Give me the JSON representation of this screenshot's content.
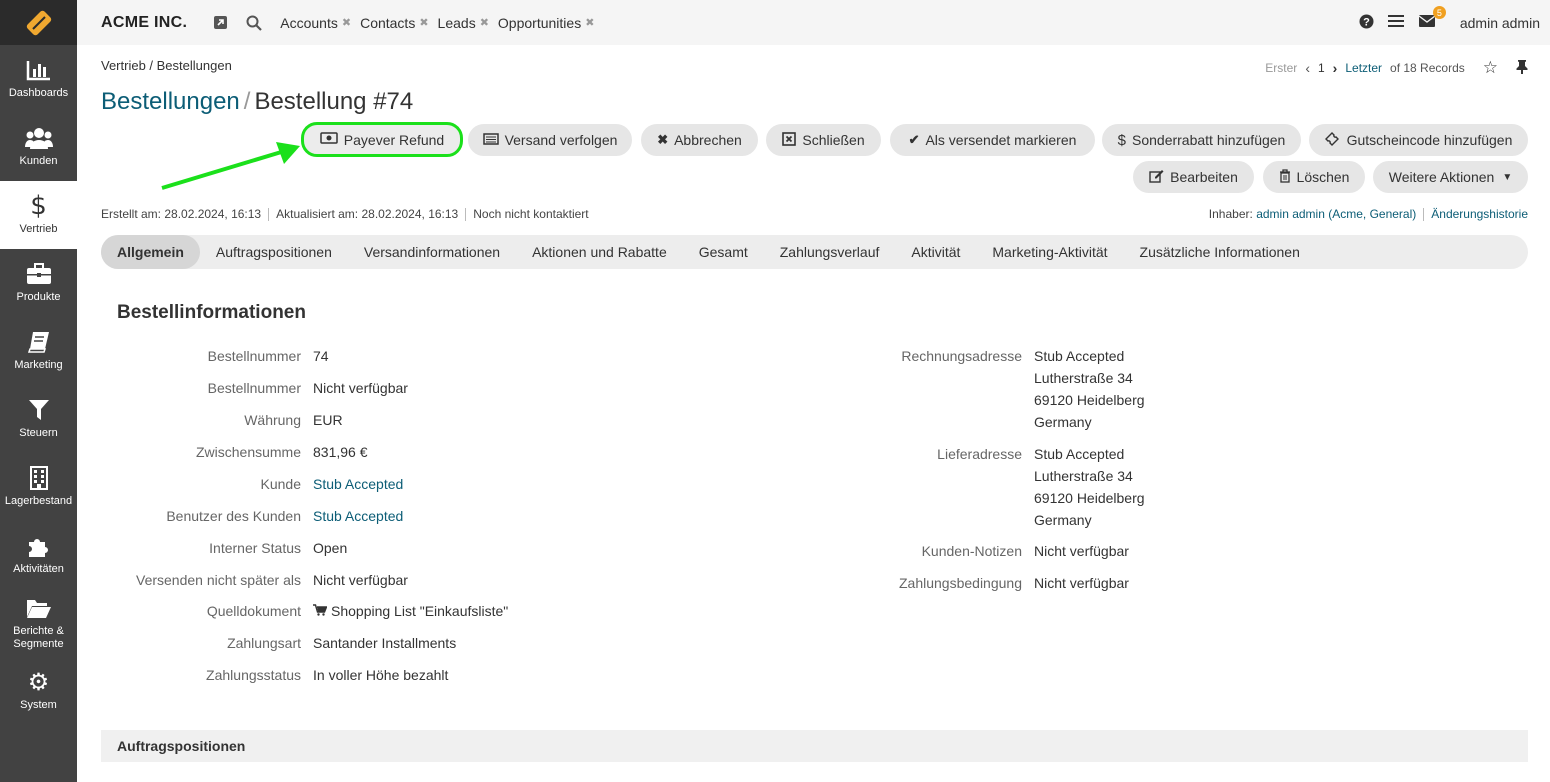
{
  "app": {
    "brand": "ACME INC."
  },
  "sidebar": {
    "items": [
      {
        "label": "Dashboards",
        "icon": "bar-chart-icon"
      },
      {
        "label": "Kunden",
        "icon": "users-icon"
      },
      {
        "label": "Vertrieb",
        "icon": "dollar-icon",
        "active": true
      },
      {
        "label": "Produkte",
        "icon": "briefcase-icon"
      },
      {
        "label": "Marketing",
        "icon": "book-icon"
      },
      {
        "label": "Steuern",
        "icon": "filter-icon"
      },
      {
        "label": "Lagerbestand",
        "icon": "building-icon"
      },
      {
        "label": "Aktivitäten",
        "icon": "puzzle-icon"
      },
      {
        "label": "Berichte & Segmente",
        "icon": "folder-icon"
      },
      {
        "label": "System",
        "icon": "gear-icon"
      }
    ]
  },
  "topbar": {
    "shortcuts": [
      "Accounts",
      "Contacts",
      "Leads",
      "Opportunities"
    ],
    "notification_count": "5",
    "user": "admin admin"
  },
  "breadcrumb": "Vertrieb / Bestellungen",
  "pager": {
    "first": "Erster",
    "page": "1",
    "last": "Letzter",
    "records": "of 18 Records"
  },
  "title": {
    "entity": "Bestellungen",
    "separator": "/",
    "record": "Bestellung #74"
  },
  "actions": {
    "payever_refund": "Payever Refund",
    "track_shipping": "Versand verfolgen",
    "cancel": "Abbrechen",
    "close": "Schließen",
    "mark_shipped": "Als versendet markieren",
    "special_discount": "Sonderrabatt hinzufügen",
    "coupon": "Gutscheincode hinzufügen",
    "edit": "Bearbeiten",
    "delete": "Löschen",
    "more": "Weitere Aktionen"
  },
  "meta": {
    "created": "Erstellt am: 28.02.2024, 16:13",
    "updated": "Aktualisiert am: 28.02.2024, 16:13",
    "contacted": "Noch nicht kontaktiert",
    "owner_label": "Inhaber:",
    "owner": "admin admin",
    "owner_org": "(Acme, General)",
    "history": "Änderungshistorie"
  },
  "tabs": [
    "Allgemein",
    "Auftragspositionen",
    "Versandinformationen",
    "Aktionen und Rabatte",
    "Gesamt",
    "Zahlungsverlauf",
    "Aktivität",
    "Marketing-Aktivität",
    "Zusätzliche Informationen"
  ],
  "section": {
    "title": "Bestellinformationen"
  },
  "fields_left": [
    {
      "label": "Bestellnummer",
      "value": "74"
    },
    {
      "label": "Bestellnummer",
      "value": "Nicht verfügbar"
    },
    {
      "label": "Währung",
      "value": "EUR"
    },
    {
      "label": "Zwischensumme",
      "value": "831,96 €"
    },
    {
      "label": "Kunde",
      "value": "Stub Accepted",
      "link": true
    },
    {
      "label": "Benutzer des Kunden",
      "value": "Stub Accepted",
      "link": true
    },
    {
      "label": "Interner Status",
      "value": "Open"
    },
    {
      "label": "Versenden nicht später als",
      "value": "Nicht verfügbar"
    },
    {
      "label": "Quelldokument",
      "value": "Shopping List \"Einkaufsliste\"",
      "icon": "cart-icon"
    },
    {
      "label": "Zahlungsart",
      "value": "Santander Installments"
    },
    {
      "label": "Zahlungsstatus",
      "value": "In voller Höhe bezahlt"
    }
  ],
  "billing": {
    "label": "Rechnungsadresse",
    "lines": [
      "Stub Accepted",
      "Lutherstraße 34",
      "69120 Heidelberg",
      "Germany"
    ]
  },
  "shipping": {
    "label": "Lieferadresse",
    "lines": [
      "Stub Accepted",
      "Lutherstraße 34",
      "69120 Heidelberg",
      "Germany"
    ]
  },
  "customer_notes": {
    "label": "Kunden-Notizen",
    "value": "Nicht verfügbar"
  },
  "payment_term": {
    "label": "Zahlungsbedingung",
    "value": "Nicht verfügbar"
  },
  "footer_section": "Auftragspositionen",
  "colors": {
    "sidebar": "#424242",
    "link": "#0c5d76",
    "highlight": "#1be01b"
  }
}
